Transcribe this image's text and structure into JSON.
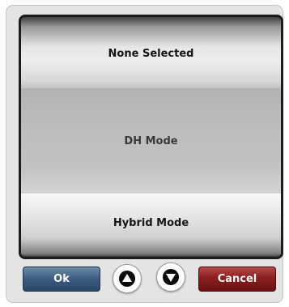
{
  "list": {
    "items": [
      {
        "label": "None Selected"
      },
      {
        "label": "DH Mode"
      },
      {
        "label": "Hybrid Mode"
      }
    ]
  },
  "buttons": {
    "ok_label": "Ok",
    "cancel_label": "Cancel",
    "up_icon": "arrow-up-icon",
    "down_icon": "arrow-down-icon"
  },
  "colors": {
    "ok": "#3f5f84",
    "cancel": "#8b1f1f"
  }
}
